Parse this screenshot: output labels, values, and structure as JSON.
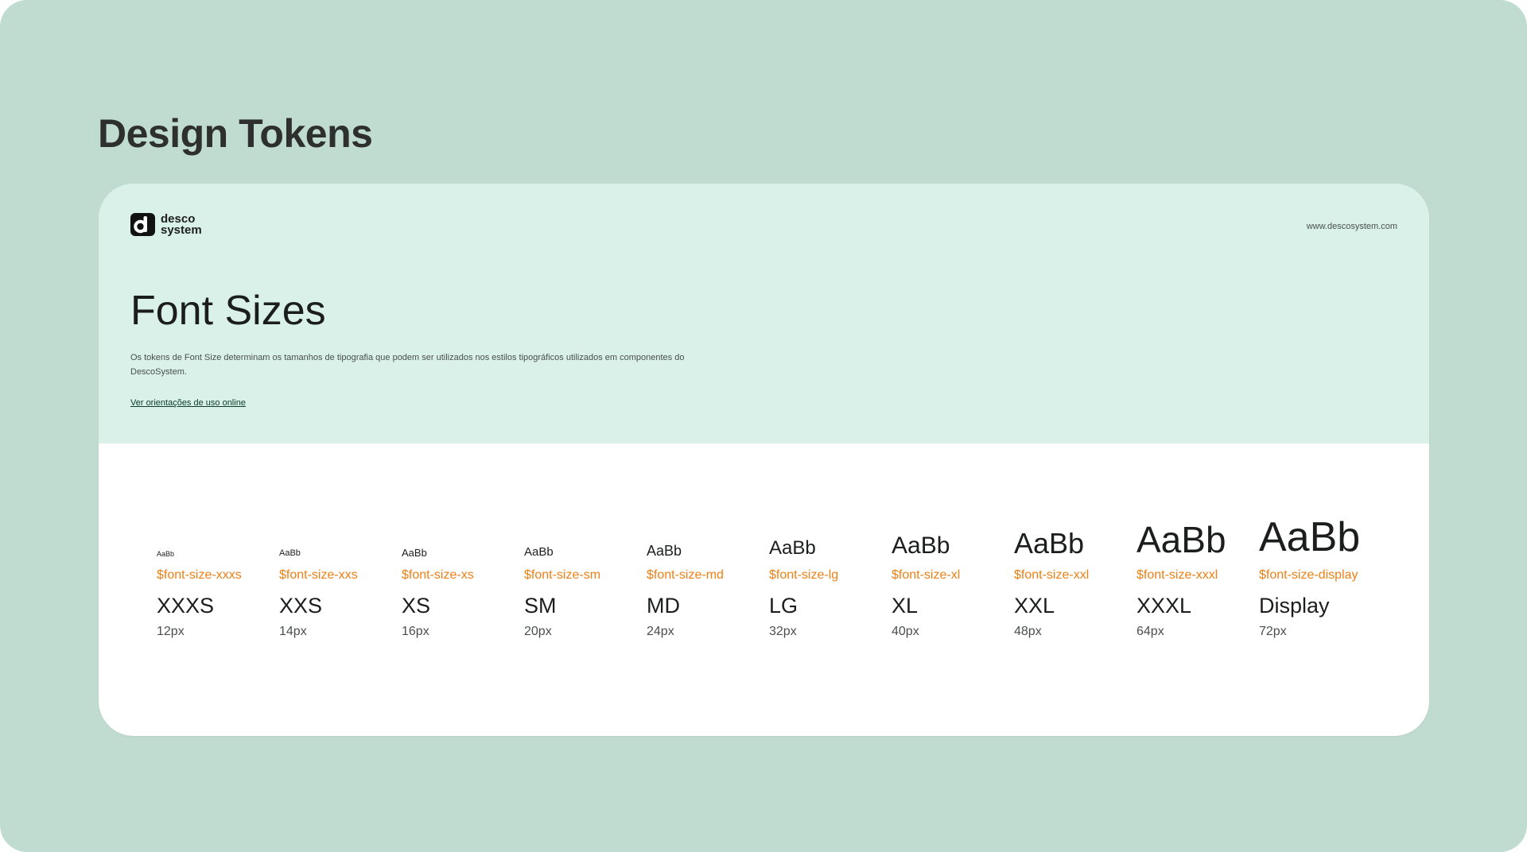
{
  "page": {
    "title": "Design Tokens"
  },
  "brand": {
    "line1": "desco",
    "line2": "system",
    "url": "www.descosystem.com"
  },
  "section": {
    "title": "Font Sizes",
    "description": "Os tokens de Font Size determinam os tamanhos de tipografia que podem ser utilizados nos estilos tipográficos utilizados em componentes do DescoSystem.",
    "link_label": "Ver orientações de uso online"
  },
  "colors": {
    "background": "#c0dbd0",
    "header": "#d9f1e8",
    "token_accent": "#f07f14"
  },
  "sizes": [
    {
      "sample": "AaBb",
      "token": "$font-size-xxxs",
      "name": "XXXS",
      "px": "12px"
    },
    {
      "sample": "AaBb",
      "token": "$font-size-xxs",
      "name": "XXS",
      "px": "14px"
    },
    {
      "sample": "AaBb",
      "token": "$font-size-xs",
      "name": "XS",
      "px": "16px"
    },
    {
      "sample": "AaBb",
      "token": "$font-size-sm",
      "name": "SM",
      "px": "20px"
    },
    {
      "sample": "AaBb",
      "token": "$font-size-md",
      "name": "MD",
      "px": "24px"
    },
    {
      "sample": "AaBb",
      "token": "$font-size-lg",
      "name": "LG",
      "px": "32px"
    },
    {
      "sample": "AaBb",
      "token": "$font-size-xl",
      "name": "XL",
      "px": "40px"
    },
    {
      "sample": "AaBb",
      "token": "$font-size-xxl",
      "name": "XXL",
      "px": "48px"
    },
    {
      "sample": "AaBb",
      "token": "$font-size-xxxl",
      "name": "XXXL",
      "px": "64px"
    },
    {
      "sample": "AaBb",
      "token": "$font-size-display",
      "name": "Display",
      "px": "72px"
    }
  ]
}
